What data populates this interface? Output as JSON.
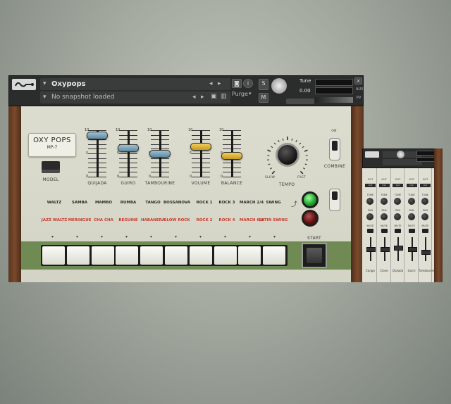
{
  "header": {
    "instrument_name": "Oxypops",
    "snapshot": "No snapshot loaded",
    "purge_label": "Purge",
    "tune_label": "Tune",
    "tune_value": "0.00",
    "aux_label": "AUX",
    "pv_label": "PV"
  },
  "instrument": {
    "nameplate_line1": "OXY POPS",
    "nameplate_line2": "MP-7",
    "model_label": "MODEL",
    "faders": [
      {
        "label": "QUIJADA",
        "color": "blue",
        "level": 0.9
      },
      {
        "label": "GUIRO",
        "color": "blue",
        "level": 0.62
      },
      {
        "label": "TAMBOURINE",
        "color": "blue",
        "level": 0.5
      },
      {
        "label": "VOLUME",
        "color": "yellow",
        "level": 0.65
      },
      {
        "label": "BALANCE",
        "color": "yellow",
        "level": 0.46
      }
    ],
    "scale_top": "10",
    "scale_mid": "5",
    "scale_bottom": "0",
    "tempo_label": "TEMPO",
    "tempo_slow": "SLOW",
    "tempo_fast": "FAST",
    "combine_on": "ON",
    "combine_label": "COMBINE",
    "rhythms_top": [
      "WALTZ",
      "SAMBA",
      "MAMBO",
      "RUMBA",
      "TANGO",
      "BOSSANOVA",
      "ROCK 1",
      "ROCK 3",
      "MARCH 2/4",
      "SWING"
    ],
    "rhythms_bottom": [
      "JAZZ WALTZ",
      "MERINGUE",
      "CHA CHA",
      "BEGUINE",
      "HABANERA",
      "SLOW ROCK",
      "ROCK 2",
      "ROCK 4",
      "MARCH 6/8",
      "LATIN SWING"
    ],
    "start_label": "START",
    "key_count": 10,
    "colors": {
      "panel": "#d8d8ca",
      "green_strip": "#6f8b53",
      "wood": "#6b4026",
      "red_text": "#c63a2c",
      "led_on": "#21a630"
    }
  },
  "mixer": {
    "channels": [
      {
        "name": "Conga"
      },
      {
        "name": "Clave"
      },
      {
        "name": "Quijada"
      },
      {
        "name": "Guiro"
      },
      {
        "name": "Tambourine"
      }
    ],
    "out_label": "OUT",
    "def_label": "Def",
    "tune_label": "TUNE",
    "pan_label": "PAN",
    "mute_label": "MUTE"
  }
}
